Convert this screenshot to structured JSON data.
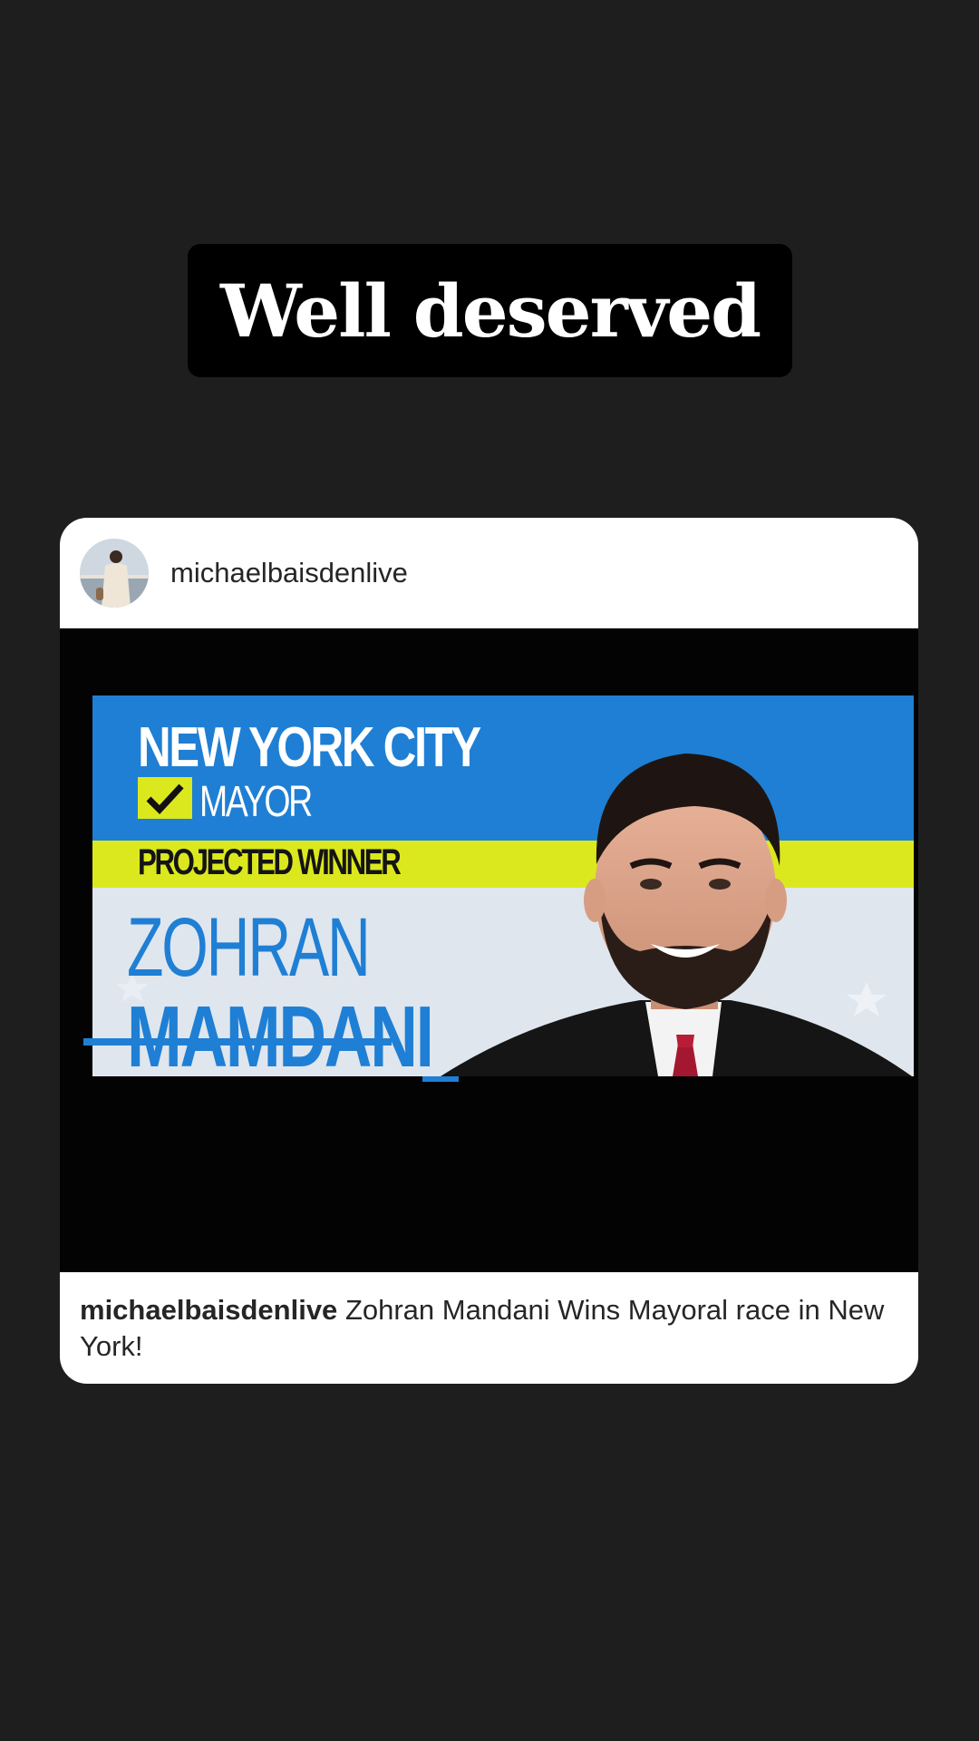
{
  "story": {
    "sticker_text": "Well deserved"
  },
  "post": {
    "username": "michaelbaisdenlive",
    "avatar_icon": "profile-photo",
    "caption_user": "michaelbaisdenlive",
    "caption_text": "Zohran Mandani Wins Mayoral race in New York!",
    "image": {
      "headline": "NEW YORK CITY",
      "race": "MAYOR",
      "status": "PROJECTED WINNER",
      "first_name": "ZOHRAN",
      "last_name": "MAMDANI",
      "colors": {
        "blue": "#1f7fd4",
        "yellow": "#dce81e",
        "light": "#dfe6ee"
      }
    }
  }
}
